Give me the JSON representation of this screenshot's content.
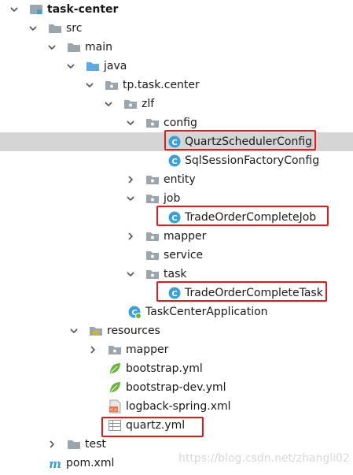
{
  "tree": {
    "project": "task-center",
    "src": "src",
    "main": "main",
    "java": "java",
    "package": "tp.task.center",
    "zlf": "zlf",
    "config": "config",
    "quartz_config": "QuartzSchedulerConfig",
    "sql_config": "SqlSessionFactoryConfig",
    "entity": "entity",
    "job": "job",
    "job_class": "TradeOrderCompleteJob",
    "mapper": "mapper",
    "service": "service",
    "task": "task",
    "task_class": "TradeOrderCompleteTask",
    "app_class": "TaskCenterApplication",
    "resources": "resources",
    "res_mapper": "mapper",
    "bootstrap": "bootstrap.yml",
    "bootstrap_dev": "bootstrap-dev.yml",
    "logback": "logback-spring.xml",
    "quartz_yml": "quartz.yml",
    "test": "test",
    "pom": "pom.xml"
  },
  "watermark": "https://blog.csdn.net/zhangli02",
  "colors": {
    "highlight_border": "#e01b1b",
    "selected_row": "#d5d5d5",
    "folder_gray": "#9aa5ad",
    "source_folder_blue": "#5fa8e0",
    "class_blue": "#3d9fd6"
  }
}
